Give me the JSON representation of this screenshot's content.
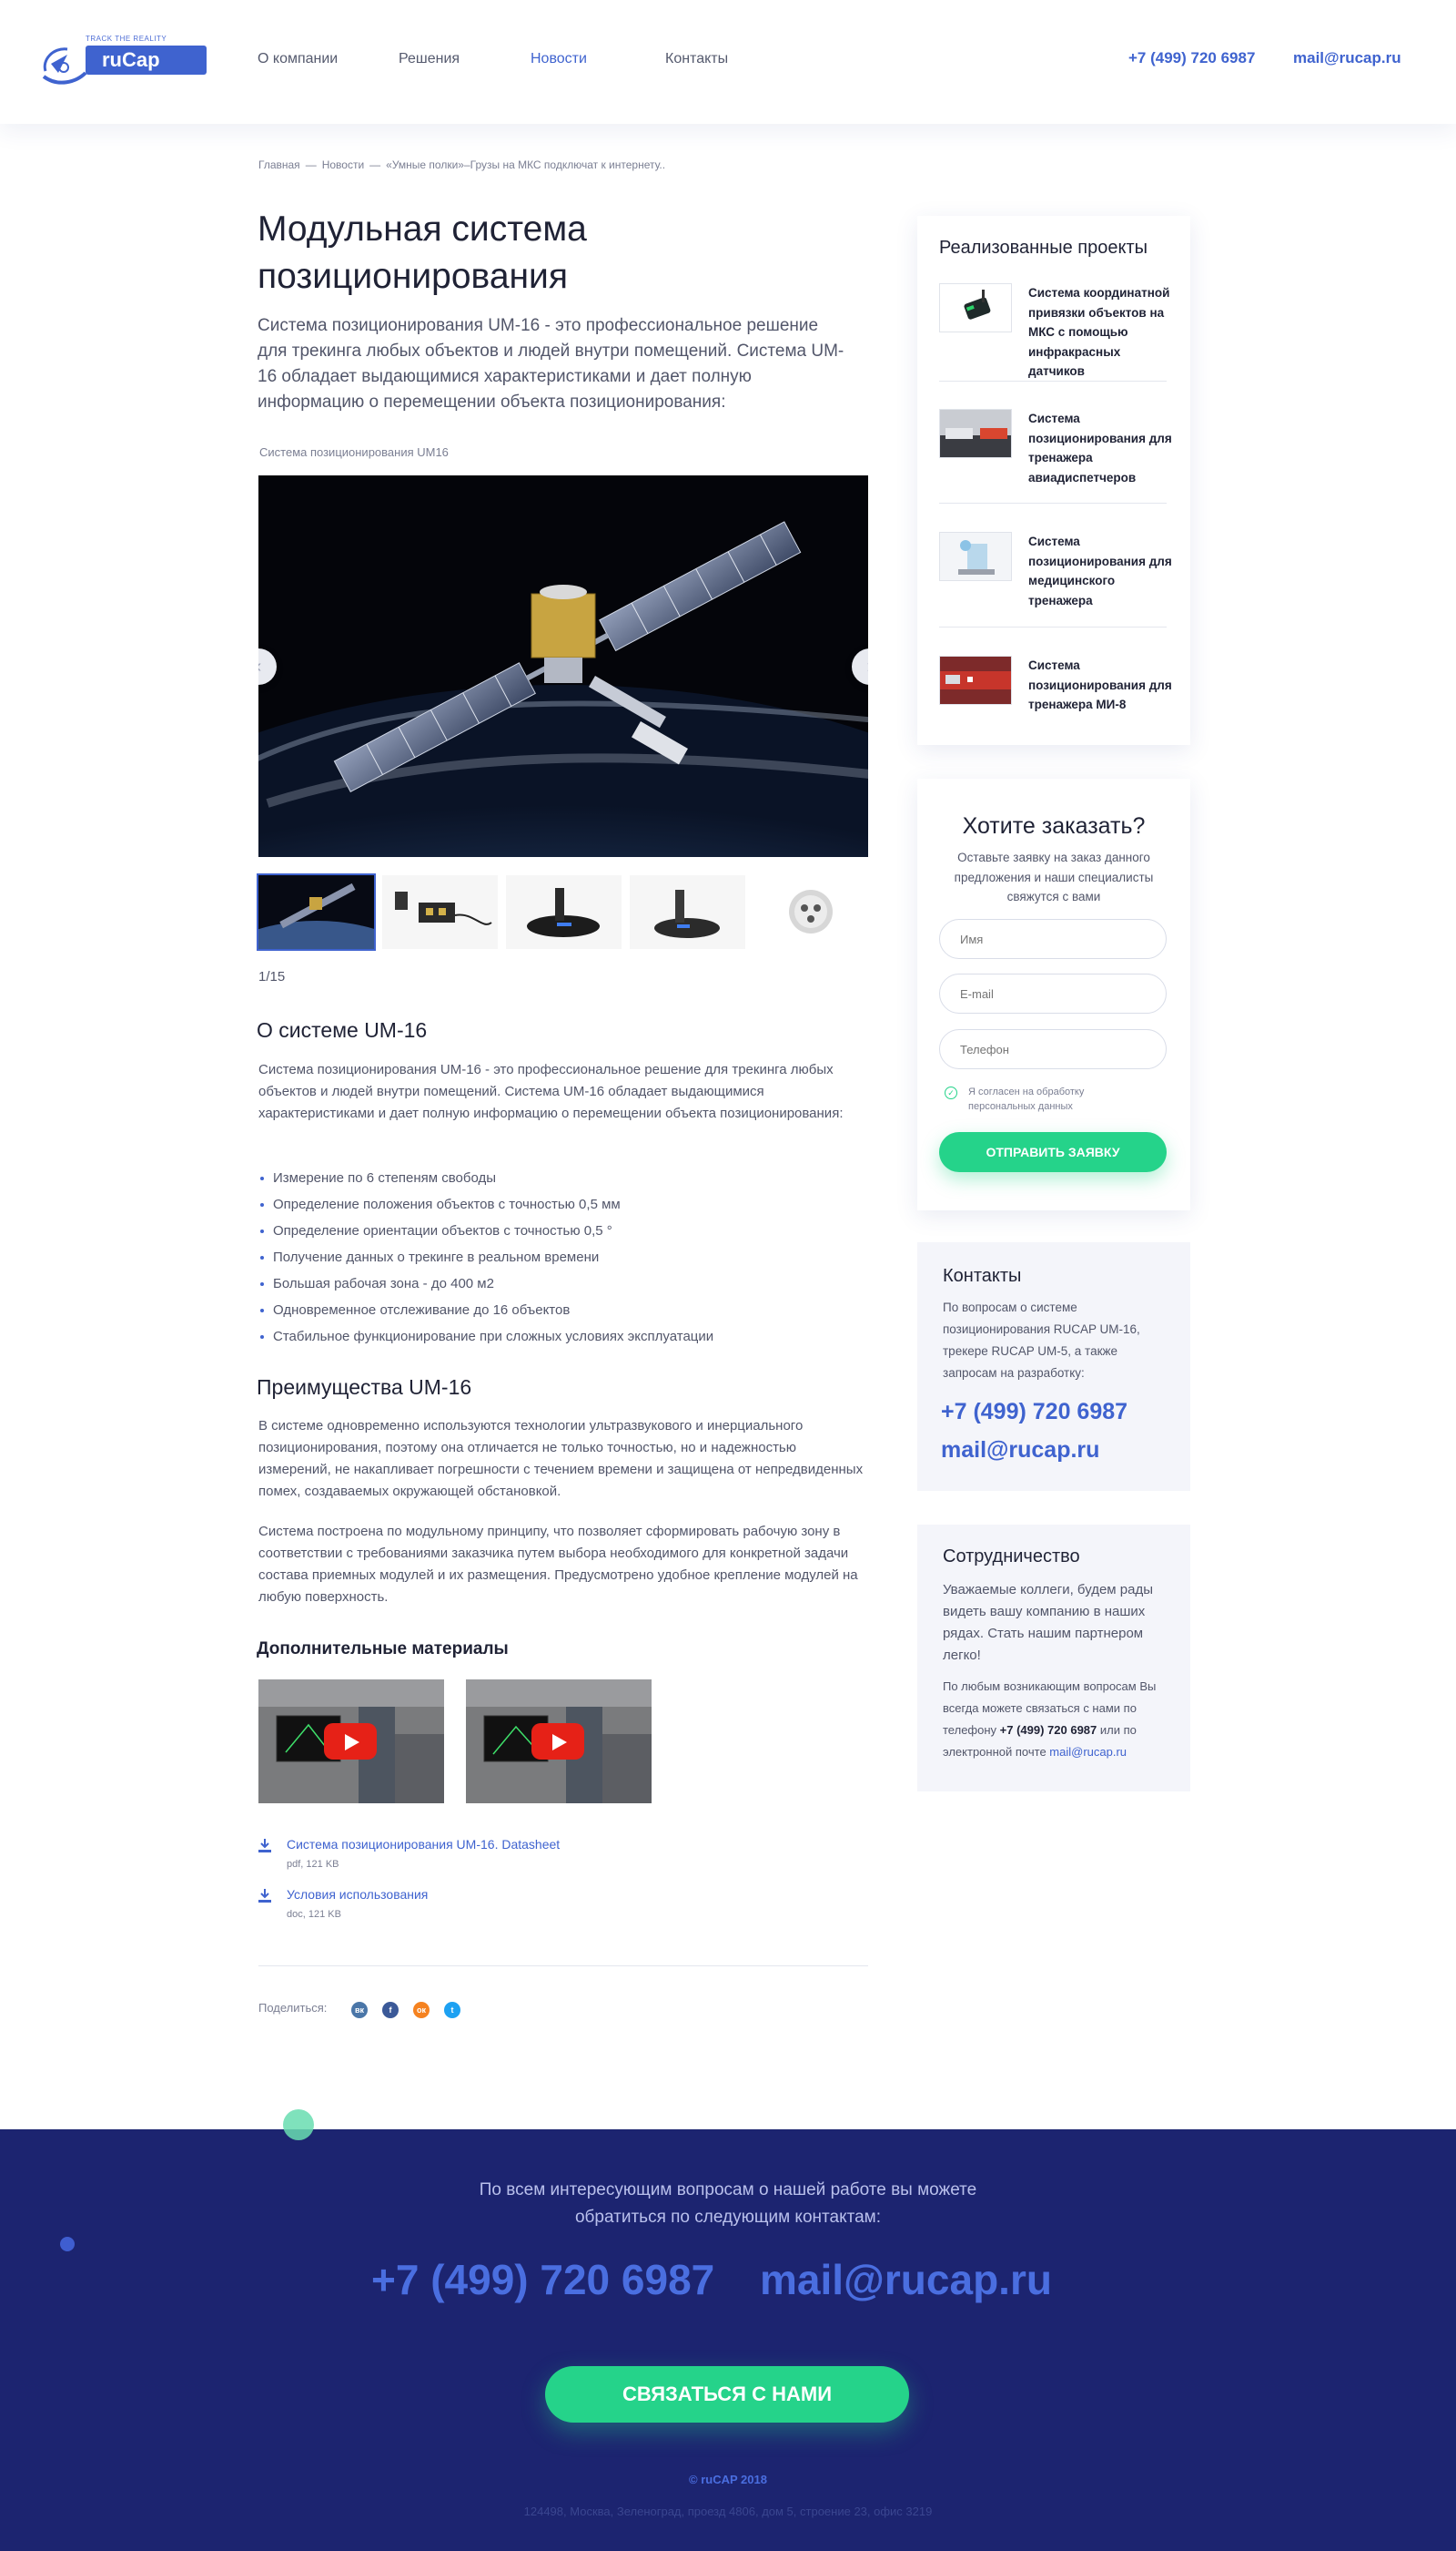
{
  "header": {
    "logo_tagline": "TRACK THE REALITY",
    "logo_text": "ruCap",
    "nav": [
      {
        "label": "О компании"
      },
      {
        "label": "Решения"
      },
      {
        "label": "Новости"
      },
      {
        "label": "Контакты"
      }
    ],
    "active_nav": "Новости",
    "phone": "+7 (499) 720 6987",
    "email": "mail@rucap.ru"
  },
  "breadcrumb": {
    "items": [
      "Главная",
      "Новости",
      "«Умные полки»–Грузы на МКС подключат к интернету.."
    ],
    "separator": "—"
  },
  "article": {
    "title": "Модульная система позиционирования",
    "lead": "Система позиционирования UM-16 - это профессиональное решение для трекинга любых объектов и людей внутри помещений. Система UM-16 обладает выдающимися характеристиками и дает полную информацию о перемещении объекта позиционирования:",
    "gallery_caption": "Система позиционирования UM16",
    "gallery_counter": "1/15",
    "about_title": "О системе UM-16",
    "about_text": "Система позиционирования UM-16 - это профессиональное решение для трекинга любых объектов и людей внутри помещений. Система UM-16 обладает выдающимися характеристиками и дает полную информацию о перемещении объекта позиционирования:",
    "features": [
      "Измерение по 6 степеням свободы",
      "Определение положения объектов с точностью 0,5 мм",
      "Определение ориентации объектов с точностью 0,5 °",
      "Получение данных о трекинге в реальном времени",
      "Большая рабочая зона - до 400 м2",
      "Одновременное отслеживание до 16 объектов",
      "Стабильное функционирование при сложных условиях эксплуатации"
    ],
    "advantages_title": "Преимущества UM-16",
    "advantages_p1": "В системе одновременно используются технологии ультразвукового и инерциального позиционирования, поэтому она отличается не только точностью, но и надежностью измерений, не накапливает погрешности с течением времени и защищена от непредвиденных помех, создаваемых окружающей обстановкой.",
    "advantages_p2": "Система построена по модульному принципу, что позволяет сформировать рабочую зону в соответствии с требованиями заказчика путем выбора необходимого для конкретной задачи состава приемных модулей и их размещения. Предусмотрено удобное крепление модулей на любую поверхность.",
    "materials_title": "Дополнительные материалы",
    "files": [
      {
        "name": "Система позиционирования UM-16. Datasheet",
        "meta": "pdf, 121 KB"
      },
      {
        "name": "Условия использования",
        "meta": "doc, 121 KB"
      }
    ],
    "share_label": "Поделиться:",
    "share_buttons": [
      {
        "icon": "vk-icon",
        "glyph": "вк",
        "color": "#4a76a8"
      },
      {
        "icon": "facebook-icon",
        "glyph": "f",
        "color": "#3b5998"
      },
      {
        "icon": "odnoklassniki-icon",
        "glyph": "ок",
        "color": "#f58220"
      },
      {
        "icon": "twitter-icon",
        "glyph": "t",
        "color": "#1da1f2"
      }
    ]
  },
  "sidebar": {
    "projects_title": "Реализованные проекты",
    "projects": [
      {
        "title": "Система координатной привязки объектов на МКС с помощью инфракрасных датчиков"
      },
      {
        "title": "Система позиционирования для тренажера авиадиспетчеров"
      },
      {
        "title": "Система позиционирования для медицинского тренажера"
      },
      {
        "title": "Система позиционирования для тренажера МИ-8"
      }
    ],
    "order": {
      "title": "Хотите заказать?",
      "subtitle": "Оставьте заявку на заказ данного предложения и наши специалисты свяжутся с вами",
      "name_placeholder": "Имя",
      "email_placeholder": "E-mail",
      "phone_placeholder": "Телефон",
      "agree_text": "Я согласен на обработку персональных данных",
      "submit_label": "ОТПРАВИТЬ ЗАЯВКУ"
    },
    "contacts": {
      "title": "Контакты",
      "text": "По вопросам о системе позиционирования RUCAP UM-16, трекере RUCAP UM-5, а также запросам на разработку:",
      "phone": "+7 (499) 720 6987",
      "email": "mail@rucap.ru"
    },
    "cooperation": {
      "title": "Сотрудничество",
      "intro": "Уважаемые коллеги, будем рады видеть вашу компанию в наших рядах. Стать нашим партнером легко!",
      "text_before_phone": "По любым возникающим вопросам Вы всегда можете связаться с нами по телефону",
      "phone": "+7 (499) 720 6987",
      "text_before_email": "или по электронной почте",
      "email": "mail@rucap.ru"
    }
  },
  "footer": {
    "text": "По всем интересующим вопросам о нашей работе вы можете обратиться по следующим контактам:",
    "phone": "+7 (499) 720 6987",
    "email": "mail@rucap.ru",
    "button_label": "СВЯЗАТЬСЯ С НАМИ",
    "copyright": "© ruCAP 2018",
    "address": "124498, Москва, Зеленоград, проезд 4806, дом 5, строение 23, офис 3219"
  },
  "colors": {
    "accent": "#3f63cf",
    "green": "#25d38a",
    "footer_bg": "#1c2470"
  }
}
